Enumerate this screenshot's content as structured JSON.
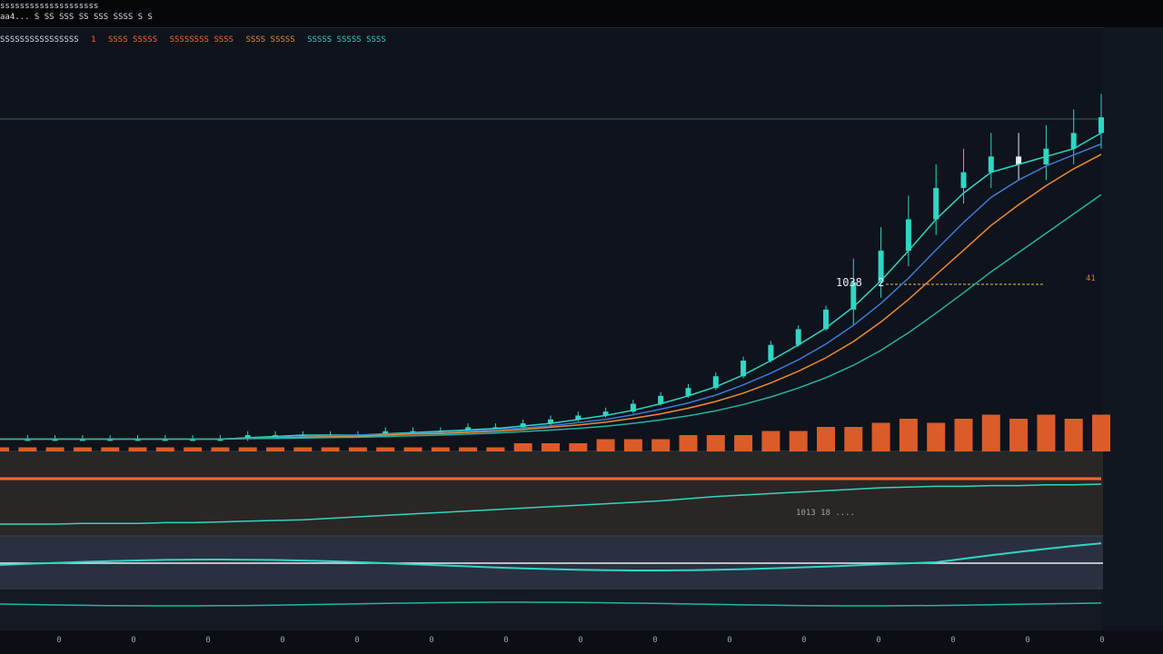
{
  "header": {
    "line1": "ssssssssssssssssssss",
    "line2": "aa4... S SS SSS SS SSS SSSS S S",
    "symbol_line": "SSSSSSSSSSSSSSSS",
    "cursor_marker": "1"
  },
  "legend": [
    {
      "text": "SSSS SSSSS",
      "color": "#ff6a2a"
    },
    {
      "text": "SSSSSSSS SSSS",
      "color": "#ff6a2a"
    },
    {
      "text": "SSSS SSSSS",
      "color": "#f08a30"
    },
    {
      "text": "SSSSS SSSSS SSSS",
      "color": "#2fd6c4"
    }
  ],
  "price_marker": {
    "label": "1038",
    "suffix": "2",
    "right_marker": "41"
  },
  "indicator_label": {
    "text": "1013 18 ....",
    "color": "#e5c34d"
  },
  "x_ticks": [
    "0",
    "0",
    "0",
    "0",
    "0",
    "0",
    "0",
    "0",
    "0",
    "0",
    "0",
    "0",
    "0",
    "0",
    "0"
  ],
  "colors": {
    "background": "#0e131c",
    "bull": "#2fd6c4",
    "bear": "#e9edf2",
    "volume": "#ff6a2a",
    "ma_orange": "#f08a30",
    "ma_blue": "#3a7bd5",
    "ma_teal": "#23b5a0"
  },
  "chart_data": {
    "type": "line",
    "x": [
      0,
      1,
      2,
      3,
      4,
      5,
      6,
      7,
      8,
      9,
      10,
      11,
      12,
      13,
      14,
      15,
      16,
      17,
      18,
      19,
      20,
      21,
      22,
      23,
      24,
      25,
      26,
      27,
      28,
      29,
      30,
      31,
      32,
      33,
      34,
      35,
      36,
      37,
      38,
      39,
      40
    ],
    "series": [
      {
        "values": [
          2,
          2,
          2,
          2,
          2,
          2,
          2,
          2,
          2,
          3,
          3,
          3,
          3,
          3,
          4,
          4,
          4,
          5,
          5,
          6,
          7,
          8,
          9,
          11,
          13,
          15,
          18,
          22,
          26,
          30,
          35,
          42,
          50,
          58,
          66,
          70,
          74,
          72,
          76,
          80,
          84
        ]
      }
    ],
    "volume": [
      1,
      1,
      1,
      1,
      1,
      1,
      1,
      1,
      1,
      1,
      1,
      1,
      1,
      1,
      1,
      1,
      1,
      1,
      1,
      2,
      2,
      2,
      3,
      3,
      3,
      4,
      4,
      4,
      5,
      5,
      6,
      6,
      7,
      8,
      7,
      8,
      9,
      8,
      9,
      8,
      9
    ],
    "oscillator": [
      10,
      10,
      10,
      11,
      11,
      11,
      12,
      12,
      13,
      14,
      15,
      16,
      18,
      20,
      22,
      24,
      26,
      28,
      30,
      32,
      34,
      36,
      38,
      40,
      42,
      45,
      48,
      50,
      52,
      54,
      56,
      58,
      60,
      61,
      62,
      62,
      63,
      63,
      64,
      64,
      65
    ],
    "ylim": [
      0,
      100
    ],
    "grid": false
  }
}
